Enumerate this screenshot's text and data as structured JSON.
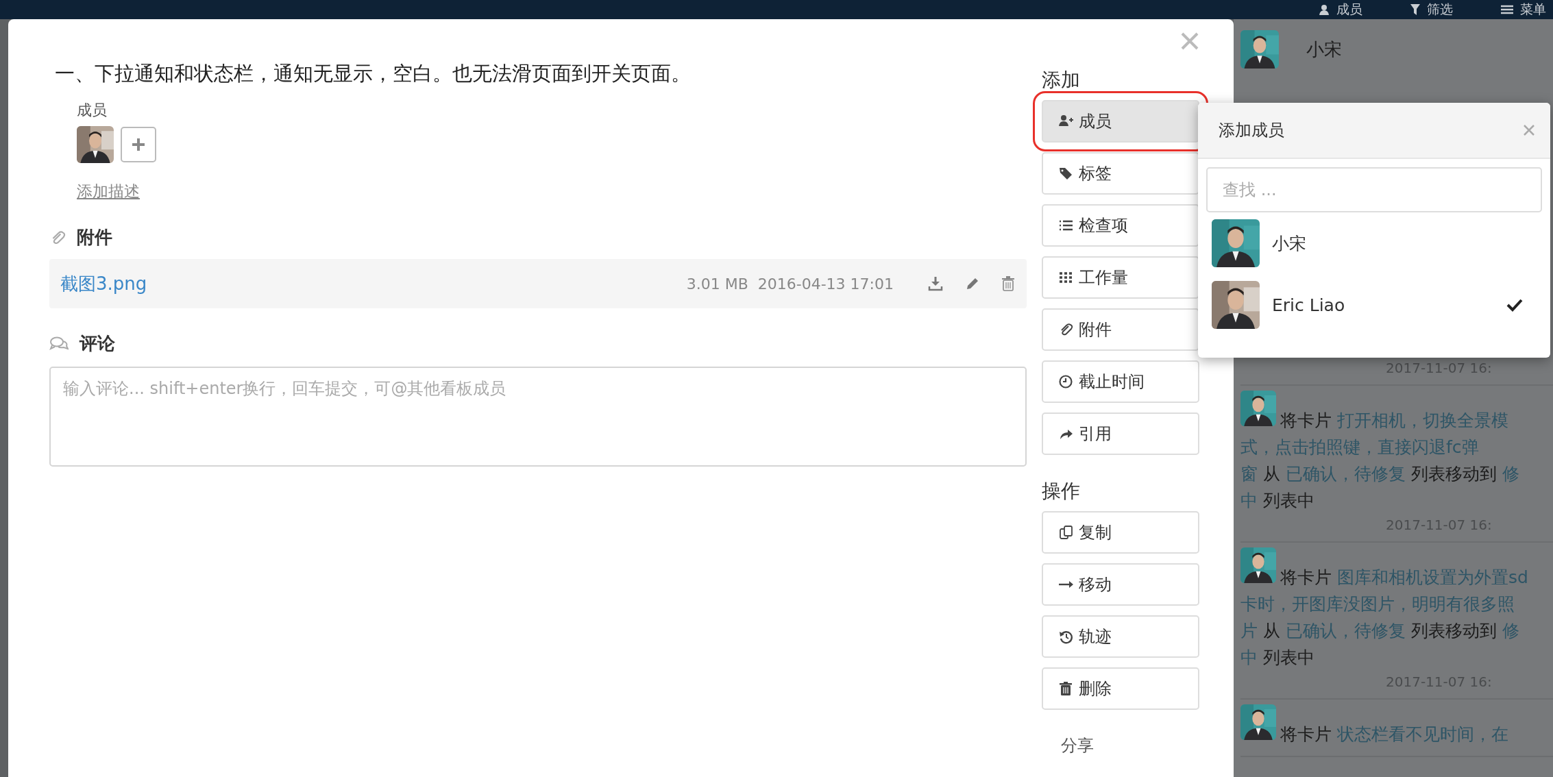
{
  "top_bar": {
    "items": [
      {
        "label": "成员"
      },
      {
        "label": "筛选"
      },
      {
        "label": "菜单"
      }
    ]
  },
  "card": {
    "title": "一、下拉通知和状态栏，通知无显示，空白。也无法滑页面到开关页面。",
    "members_label": "成员",
    "add_description": "添加描述",
    "attachments": {
      "heading": "附件",
      "files": [
        {
          "name": "截图3.png",
          "size": "3.01 MB",
          "date": "2016-04-13 17:01"
        }
      ]
    },
    "comments": {
      "heading": "评论",
      "placeholder": "输入评论... shift+enter换行，回车提交，可@其他看板成员"
    }
  },
  "sidebar": {
    "sections": [
      {
        "heading": "添加",
        "buttons": [
          {
            "label": "成员",
            "selected": true
          },
          {
            "label": "标签",
            "selected": false
          },
          {
            "label": "检查项",
            "selected": false
          },
          {
            "label": "工作量",
            "selected": false
          },
          {
            "label": "附件",
            "selected": false
          },
          {
            "label": "截止时间",
            "selected": false
          },
          {
            "label": "引用",
            "selected": false
          }
        ]
      },
      {
        "heading": "操作",
        "buttons": [
          {
            "label": "复制",
            "selected": false
          },
          {
            "label": "移动",
            "selected": false
          },
          {
            "label": "轨迹",
            "selected": false
          },
          {
            "label": "删除",
            "selected": false
          }
        ]
      }
    ],
    "share": "分享"
  },
  "popup": {
    "title": "添加成员",
    "search": {
      "placeholder": "查找 ..."
    },
    "members": [
      {
        "name": "小宋",
        "checked": false
      },
      {
        "name": "Eric Liao",
        "checked": true
      }
    ]
  },
  "activity": {
    "header": {
      "name": "小宋"
    },
    "entries": [
      {
        "time": "2017-11-07 16:"
      },
      {
        "lines": [
          [
            {
              "text": "将卡片",
              "link": false
            },
            {
              "text": "打开相机，切换全景模",
              "link": true
            }
          ],
          [
            {
              "text": "式，点击拍照键，直接闪退fc弹",
              "link": true
            }
          ],
          [
            {
              "text": "窗",
              "link": true
            },
            {
              "text": "从",
              "link": false
            },
            {
              "text": "已确认，待修复",
              "link": true
            },
            {
              "text": "列表移动到",
              "link": false
            },
            {
              "text": "修",
              "link": true
            }
          ],
          [
            {
              "text": "中",
              "link": true
            },
            {
              "text": "列表中",
              "link": false
            }
          ]
        ],
        "time": "2017-11-07 16:"
      },
      {
        "lines": [
          [
            {
              "text": "将卡片",
              "link": false
            },
            {
              "text": "图库和相机设置为外置sd",
              "link": true
            }
          ],
          [
            {
              "text": "卡时，开图库没图片，明明有很多照",
              "link": true
            }
          ],
          [
            {
              "text": "片",
              "link": true
            },
            {
              "text": "从",
              "link": false
            },
            {
              "text": "已确认，待修复",
              "link": true
            },
            {
              "text": "列表移动到",
              "link": false
            },
            {
              "text": "修",
              "link": true
            }
          ],
          [
            {
              "text": "中",
              "link": true
            },
            {
              "text": "列表中",
              "link": false
            }
          ]
        ],
        "time": "2017-11-07 16:"
      },
      {
        "lines": [
          [
            {
              "text": "将卡片",
              "link": false
            },
            {
              "text": "状态栏看不见时间，在",
              "link": true
            }
          ]
        ]
      }
    ]
  }
}
